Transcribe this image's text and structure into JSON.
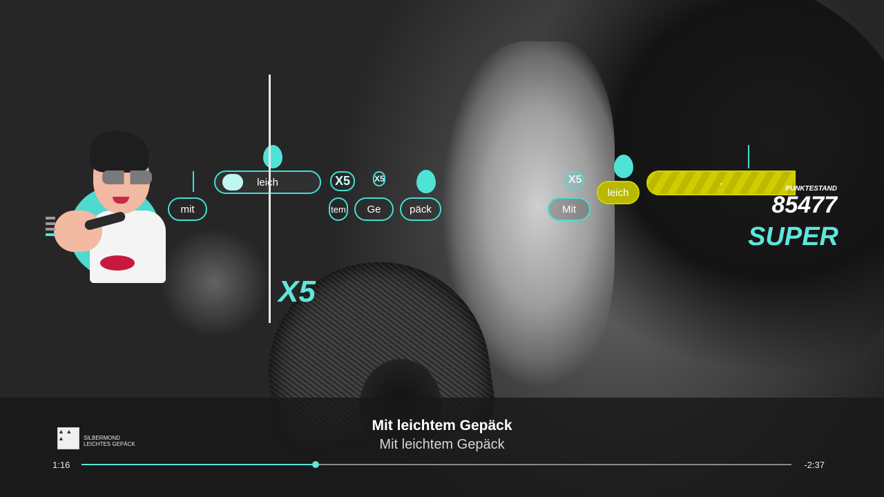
{
  "song": {
    "artist": "SILBERMOND",
    "title": "LEICHTES GEPÄCK",
    "cover_text": "▲ ▲ ▲"
  },
  "notes": [
    {
      "label": "mit"
    },
    {
      "label": "leich"
    },
    {
      "label": "tem"
    },
    {
      "label": "Ge"
    },
    {
      "label": "päck"
    },
    {
      "label": "Mit"
    },
    {
      "label": "leich"
    }
  ],
  "multiplier_badges": [
    "X5",
    "X5",
    "X5"
  ],
  "gold_bar_label": "-",
  "score": {
    "label": "PUNKTESTAND",
    "value": "85477",
    "rating": "SUPER"
  },
  "multiplier_big": "X5",
  "lyrics": {
    "current": "Mit leichtem Gepäck",
    "next": "Mit leichtem Gepäck"
  },
  "progress": {
    "elapsed": "1:16",
    "remaining": "-2:37",
    "fraction": 0.33
  },
  "colors": {
    "accent": "#4fe3d8",
    "gold": "#cfcd00"
  }
}
